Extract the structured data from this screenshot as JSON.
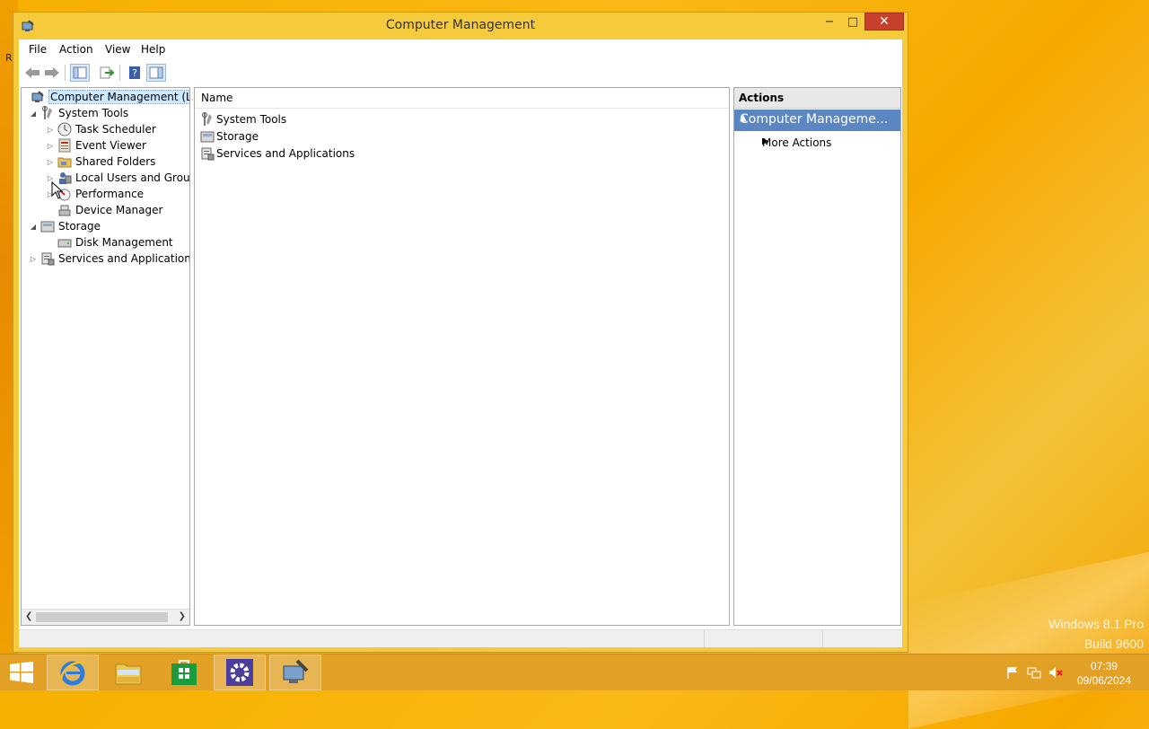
{
  "window": {
    "title": "Computer Management",
    "min_glyph": "−",
    "max_glyph": "□",
    "close_glyph": "✕"
  },
  "menu": [
    "File",
    "Action",
    "View",
    "Help"
  ],
  "tree": {
    "items": [
      {
        "label": "Computer Management (Local",
        "expander": "",
        "selected": true
      },
      {
        "label": "System Tools",
        "expander": "◢"
      },
      {
        "label": "Task Scheduler",
        "expander": "▷"
      },
      {
        "label": "Event Viewer",
        "expander": "▷"
      },
      {
        "label": "Shared Folders",
        "expander": "▷"
      },
      {
        "label": "Local Users and Groups",
        "expander": "▷"
      },
      {
        "label": "Performance",
        "expander": "▷"
      },
      {
        "label": "Device Manager",
        "expander": ""
      },
      {
        "label": "Storage",
        "expander": "◢"
      },
      {
        "label": "Disk Management",
        "expander": ""
      },
      {
        "label": "Services and Applications",
        "expander": "▷"
      }
    ]
  },
  "list": {
    "column_header": "Name",
    "rows": [
      "System Tools",
      "Storage",
      "Services and Applications"
    ]
  },
  "actions": {
    "title": "Actions",
    "group_label": "Computer Manageme...",
    "more_actions": "More Actions"
  },
  "desktop": {
    "edition": "Windows 8.1 Pro",
    "build": "Build 9600",
    "edge_letter": "R"
  },
  "clock": {
    "time": "07:39",
    "date": "09/06/2024"
  },
  "colors": {
    "accent": "#5a86c2",
    "close_red": "#c7402e",
    "frame": "#f5ca3c",
    "taskbar": "#e2a024"
  }
}
